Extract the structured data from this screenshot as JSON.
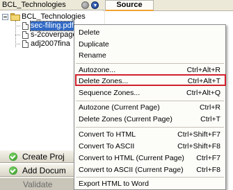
{
  "left_panel": {
    "title": "BCL_Technologies",
    "tree": {
      "root_label": "BCL_Technologies",
      "items": [
        {
          "label": "sec-filing.pdf",
          "selected": true
        },
        {
          "label": "s-2coverpage"
        },
        {
          "label": "adj2007fina"
        }
      ]
    },
    "buttons": [
      {
        "label": "Create Proj",
        "icon": "check-circle-icon"
      },
      {
        "label": "Add Docum",
        "icon": "check-circle-icon"
      },
      {
        "label": "Validate",
        "disabled": true
      }
    ]
  },
  "tabs": {
    "source_label": "Source"
  },
  "context_menu": {
    "items": [
      {
        "label": "Delete",
        "shortcut": ""
      },
      {
        "label": "Duplicate",
        "shortcut": ""
      },
      {
        "label": "Rename",
        "shortcut": ""
      },
      {
        "label": "Autozone...",
        "shortcut": "Ctrl+Alt+R"
      },
      {
        "label": "Delete Zones...",
        "shortcut": "Ctrl+Alt+T",
        "highlighted": true
      },
      {
        "label": "Sequence Zones...",
        "shortcut": "Ctrl+Alt+Q"
      },
      {
        "label": "Autozone (Current Page)",
        "shortcut": "Ctrl+R"
      },
      {
        "label": "Delete Zones (Current Page)",
        "shortcut": "Ctrl+T"
      },
      {
        "label": "Convert To HTML",
        "shortcut": "Ctrl+Shift+F7"
      },
      {
        "label": "Convert To ASCII",
        "shortcut": "Ctrl+Shift+F8"
      },
      {
        "label": "Convert to HTML (Current Page)",
        "shortcut": "Ctrl+F7"
      },
      {
        "label": "Convert to ASCII (Current Page)",
        "shortcut": "Ctrl+F8"
      },
      {
        "label": "Export HTML to Word",
        "shortcut": ""
      }
    ]
  },
  "colors": {
    "highlight_border": "#d0202c",
    "selection": "#316ac5",
    "tab_accent": "#f0a330"
  }
}
